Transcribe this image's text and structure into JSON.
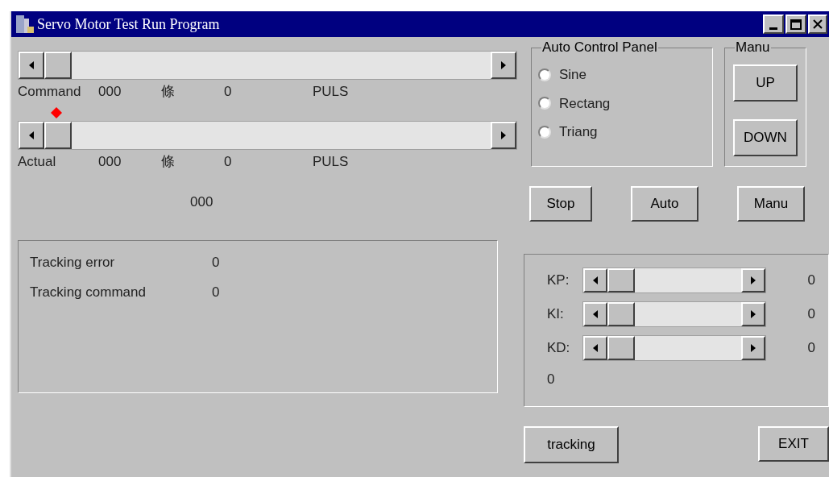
{
  "window": {
    "title": "Servo Motor Test Run Program"
  },
  "position_sliders": [
    {
      "label": "Command",
      "value": "000",
      "unit_char": "條",
      "count": "0",
      "unit": "PULS",
      "marker": false
    },
    {
      "label": "Actual",
      "value": "000",
      "unit_char": "條",
      "count": "0",
      "unit": "PULS",
      "marker": true
    }
  ],
  "readout": "000",
  "auto_control_panel": {
    "title": "Auto Control Panel",
    "options": [
      {
        "label": "Sine",
        "selected": false
      },
      {
        "label": "Rectang",
        "selected": false
      },
      {
        "label": "Triang",
        "selected": false
      }
    ]
  },
  "manu_panel": {
    "title": "Manu",
    "buttons": [
      "UP",
      "DOWN"
    ]
  },
  "mode_buttons": [
    "Stop",
    "Auto",
    "Manu"
  ],
  "tracking_panel": {
    "rows": [
      {
        "label": "Tracking error",
        "value": "0"
      },
      {
        "label": "Tracking command",
        "value": "0"
      }
    ]
  },
  "gain_panel": {
    "sliders": [
      {
        "label": "KP:",
        "value": "0"
      },
      {
        "label": "KI:",
        "value": "0"
      },
      {
        "label": "KD:",
        "value": "0"
      }
    ],
    "readout": "0"
  },
  "buttons": [
    "tracking",
    "EXIT"
  ]
}
